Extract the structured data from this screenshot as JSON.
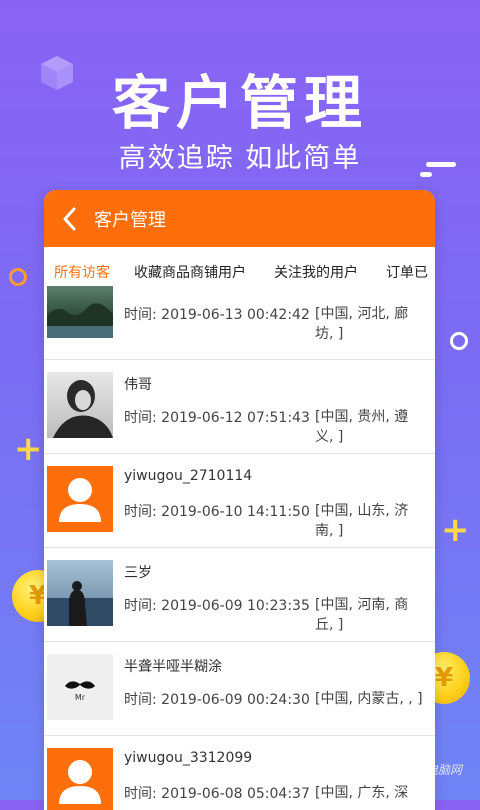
{
  "promo": {
    "title": "客户管理",
    "subtitle": "高效追踪 如此简单"
  },
  "appbar": {
    "back_icon": "chevron-left-icon",
    "title": "客户管理"
  },
  "tabs": [
    {
      "label": "所有访客",
      "active": true
    },
    {
      "label": "收藏商品商铺用户",
      "active": false
    },
    {
      "label": "关注我的用户",
      "active": false
    },
    {
      "label": "订单已",
      "active": false
    }
  ],
  "visitors": [
    {
      "name": "",
      "time": "时间: 2019-06-13 00:42:42",
      "location": "[中国, 河北, 廊坊, ]",
      "avatar": "landscape-photo"
    },
    {
      "name": "伟哥",
      "time": "时间: 2019-06-12 07:51:43",
      "location": "[中国, 贵州, 遵义, ]",
      "avatar": "bw-portrait-photo"
    },
    {
      "name": "yiwugou_2710114",
      "time": "时间: 2019-06-10 14:11:50",
      "location": "[中国, 山东, 济南, ]",
      "avatar": "default-user-avatar"
    },
    {
      "name": "三岁",
      "time": "时间: 2019-06-09 10:23:35",
      "location": "[中国, 河南, 商丘, ]",
      "avatar": "seaside-photo"
    },
    {
      "name": "半聋半哑半糊涂",
      "time": "时间: 2019-06-09 00:24:30",
      "location": "[中国, 内蒙古, , ]",
      "avatar": "mustache-logo",
      "avatar_text": "Mr"
    },
    {
      "name": "yiwugou_3312099",
      "time": "时间: 2019-06-08 05:04:37",
      "location": "[中国, 广东, 深",
      "avatar": "default-user-avatar"
    }
  ],
  "watermark": "PConline 太平洋电脑网",
  "colors": {
    "accent": "#fe6f0c",
    "bg_top": "#8a63f5",
    "bg_bottom": "#6f85f6",
    "avatar_default": "#fe6f0c"
  }
}
